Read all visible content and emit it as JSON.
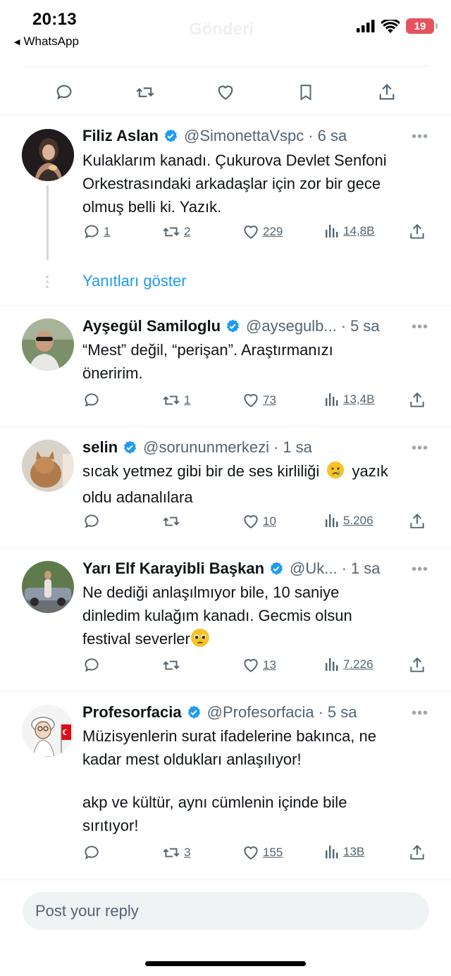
{
  "status_bar": {
    "time": "20:13",
    "back_app": "WhatsApp",
    "ghost_title": "Gönderi",
    "battery": "19"
  },
  "reply_placeholder": "Post your reply",
  "show_replies": "Yanıtları göster",
  "colors": {
    "accent": "#1d9bf0",
    "verified": "#1d9bf0",
    "muted": "#536471",
    "battery": "#e5545d"
  },
  "replies": [
    {
      "name": "Filiz Aslan",
      "handle": "@SimonettaVspc",
      "time": "6 sa",
      "text": [
        "Kulaklarım kanadı. Çukurova Devlet Senfoni",
        "Orkestrasındaki arkadaşlar için zor bir gece",
        "olmuş belli ki. Yazık."
      ],
      "replies": "1",
      "reposts": "2",
      "likes": "229",
      "views": "14,8B"
    },
    {
      "name": "Ayşegül Samiloglu",
      "handle": "@aysegulb...",
      "time": "5 sa",
      "text": [
        "“Mest” değil, “perişan”. Araştırmanızı",
        "öneririm."
      ],
      "replies": "",
      "reposts": "1",
      "likes": "73",
      "views": "13,4B"
    },
    {
      "name": "selin",
      "handle": "@sorununmerkezi",
      "time": "1 sa",
      "text": [
        "sıcak yetmez gibi bir de ses kirliliği",
        "oldu adanalılara"
      ],
      "text_tail": "yazık",
      "replies": "",
      "reposts": "",
      "likes": "10",
      "views": "5.206"
    },
    {
      "name": "Yarı Elf Karayibli Başkan",
      "handle": "@Uk...",
      "time": "1 sa",
      "text": [
        "Ne dediği anlaşılmıyor bile, 10 saniye",
        "dinledim kulağım kanadı. Gecmis olsun",
        "festival severler"
      ],
      "replies": "",
      "reposts": "",
      "likes": "13",
      "views": "7.226"
    },
    {
      "name": "Profesorfacia",
      "handle": "@Profesorfacia",
      "time": "5 sa",
      "text": [
        "Müzisyenlerin surat ifadelerine bakınca, ne",
        "kadar mest oldukları anlaşılıyor!",
        "",
        "akp ve kültür, aynı cümlenin içinde bile",
        "sırıtıyor!"
      ],
      "replies": "",
      "reposts": "3",
      "likes": "155",
      "views": "13B"
    }
  ]
}
